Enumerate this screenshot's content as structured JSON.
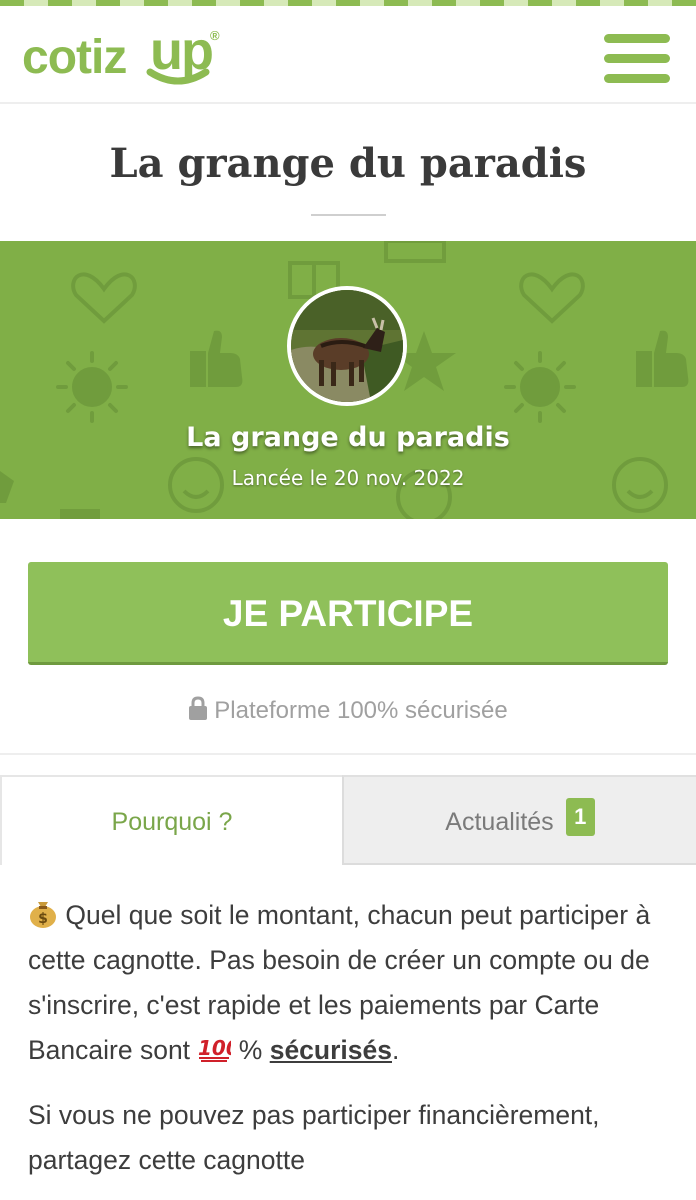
{
  "header": {
    "logo_text": "cotiz",
    "logo_up": "up",
    "logo_reg": "®",
    "menu_icon": "hamburger-menu-icon"
  },
  "page": {
    "title": "La grange du paradis"
  },
  "banner": {
    "title": "La grange du paradis",
    "launch_date": "Lancée le 20 nov. 2022",
    "avatar": "goat-photo"
  },
  "cta": {
    "label": "JE PARTICIPE"
  },
  "security": {
    "icon": "lock-icon",
    "text": "Plateforme 100% sécurisée"
  },
  "tabs": [
    {
      "label": "Pourquoi ?",
      "active": true
    },
    {
      "label": "Actualités",
      "badge": "1",
      "active": false
    }
  ],
  "content": {
    "para1_main": " Quel que soit le montant, chacun peut participer à cette cagnotte. Pas besoin de créer un compte ou de s'inscrire, c'est rapide et les paiements par Carte Bancaire sont ",
    "para1_pct": " % ",
    "para1_link": "sécurisés",
    "para1_end": ".",
    "para2": "Si vous ne pouvez pas participer financièrement, partagez cette cagnotte"
  },
  "colors": {
    "brand_green": "#8dbb52",
    "banner_green": "#80af47",
    "cta_green": "#8fc05a"
  }
}
